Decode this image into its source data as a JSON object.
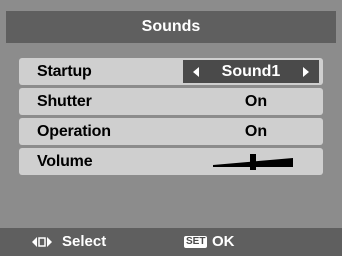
{
  "title": "Sounds",
  "menu": {
    "items": [
      {
        "label": "Startup",
        "value": "Sound1"
      },
      {
        "label": "Shutter",
        "value": "On"
      },
      {
        "label": "Operation",
        "value": "On"
      },
      {
        "label": "Volume",
        "value": ""
      }
    ]
  },
  "volume": {
    "level": 0.5
  },
  "footer": {
    "select_label": "Select",
    "set_badge": "SET",
    "ok_label": "OK"
  },
  "colors": {
    "screen_bg": "#8c8c8c",
    "bar_bg": "#5f5f5f",
    "row_bg": "#cfcfcf",
    "selected_value_bg": "#4a4a4a"
  }
}
